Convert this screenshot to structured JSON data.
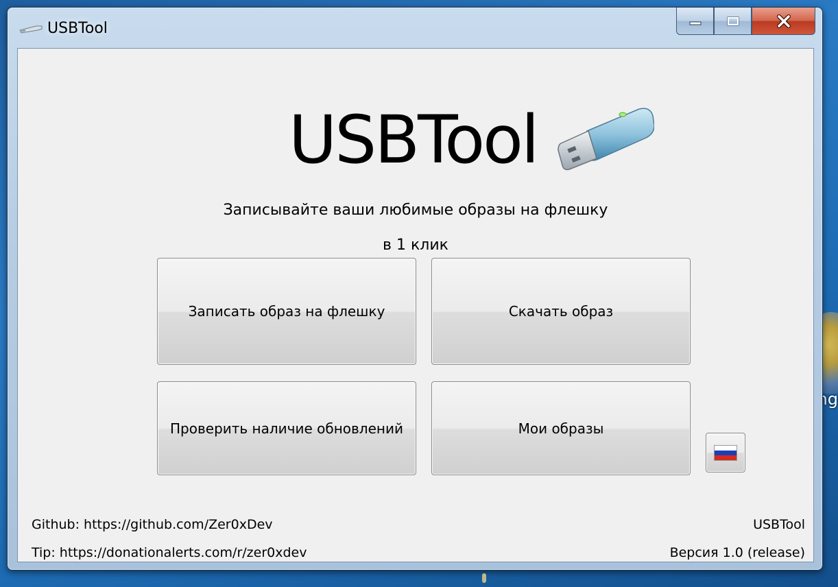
{
  "window": {
    "title": "USBTool",
    "controls": {
      "minimize": "minimize",
      "maximize": "maximize",
      "close": "close"
    }
  },
  "hero": {
    "title": "USBTool",
    "icon": "usb-drive-icon"
  },
  "subtitle": {
    "line1": "Записывайте ваши любимые образы на флешку",
    "line2": "в 1 клик"
  },
  "buttons": {
    "write_image": "Записать образ на флешку",
    "download_image": "Скачать образ",
    "check_updates": "Проверить наличие обновлений",
    "my_images": "Мои образы",
    "language_flag": "russian-flag-icon"
  },
  "footer": {
    "github": "Github: https://github.com/Zer0xDev",
    "tip": "Tip: https://donationalerts.com/r/zer0xdev",
    "app_name": "USBTool",
    "version": "Версия 1.0 (release)"
  },
  "desktop": {
    "partial_label": "ng"
  },
  "colors": {
    "flag_white": "#ffffff",
    "flag_blue": "#1c3fb5",
    "flag_red": "#d52b1e",
    "close_button": "#c4472f",
    "client_background": "#f0f0f0"
  }
}
